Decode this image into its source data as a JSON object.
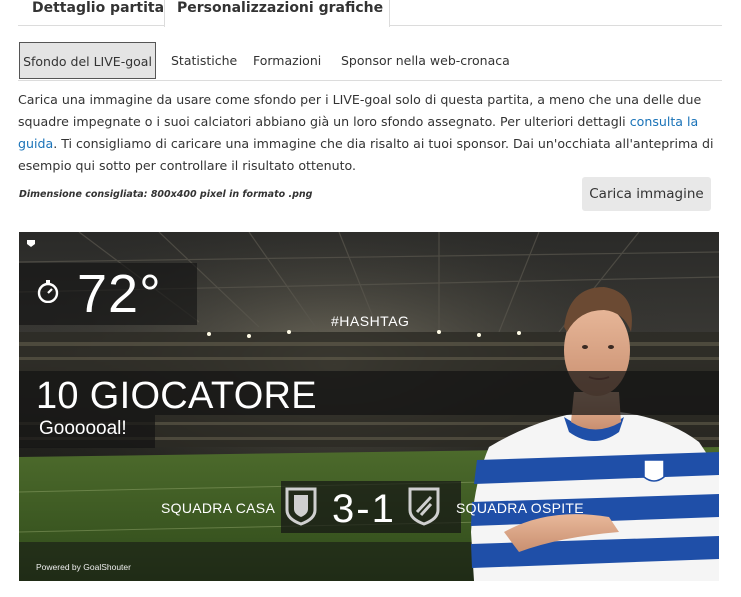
{
  "tabs": {
    "main": [
      "Dettaglio partita",
      "Personalizzazioni grafiche"
    ],
    "sub": [
      "Sfondo del LIVE-goal",
      "Statistiche",
      "Formazioni",
      "Sponsor nella web-cronaca"
    ]
  },
  "description": {
    "part1": "Carica una immagine da usare come sfondo per i LIVE-goal solo di questa partita, a meno che una delle due squadre impegnate o i suoi calciatori abbiano già un loro sfondo assegnato. Per ulteriori dettagli ",
    "link": "consulta la guida",
    "part2": ". Ti consigliamo di caricare una immagine che dia risalto ai tuoi sponsor. Dai un'occhiata all'anteprima di esempio qui sotto per controllare il risultato ottenuto."
  },
  "dimension_note": "Dimensione consigliata: 800x400 pixel in formato .png",
  "upload_button": "Carica immagine",
  "preview": {
    "minute": "72°",
    "hashtag": "#HASHTAG",
    "player": "10 GIOCATORE",
    "goal_text": "Goooooal!",
    "home_team": "SQUADRA CASA",
    "away_team": "SQUADRA OSPITE",
    "score": "3-1",
    "powered_by": "Powered by GoalShouter",
    "icons": [
      "stopwatch-icon",
      "shield-icon",
      "logo-icon"
    ]
  },
  "colors": {
    "link": "#1a73b8",
    "active_tab_bg": "#e4e4e4",
    "button_bg": "#e8e8e8",
    "overlay": "#141414",
    "jersey_blue": "#1f4fa8"
  }
}
